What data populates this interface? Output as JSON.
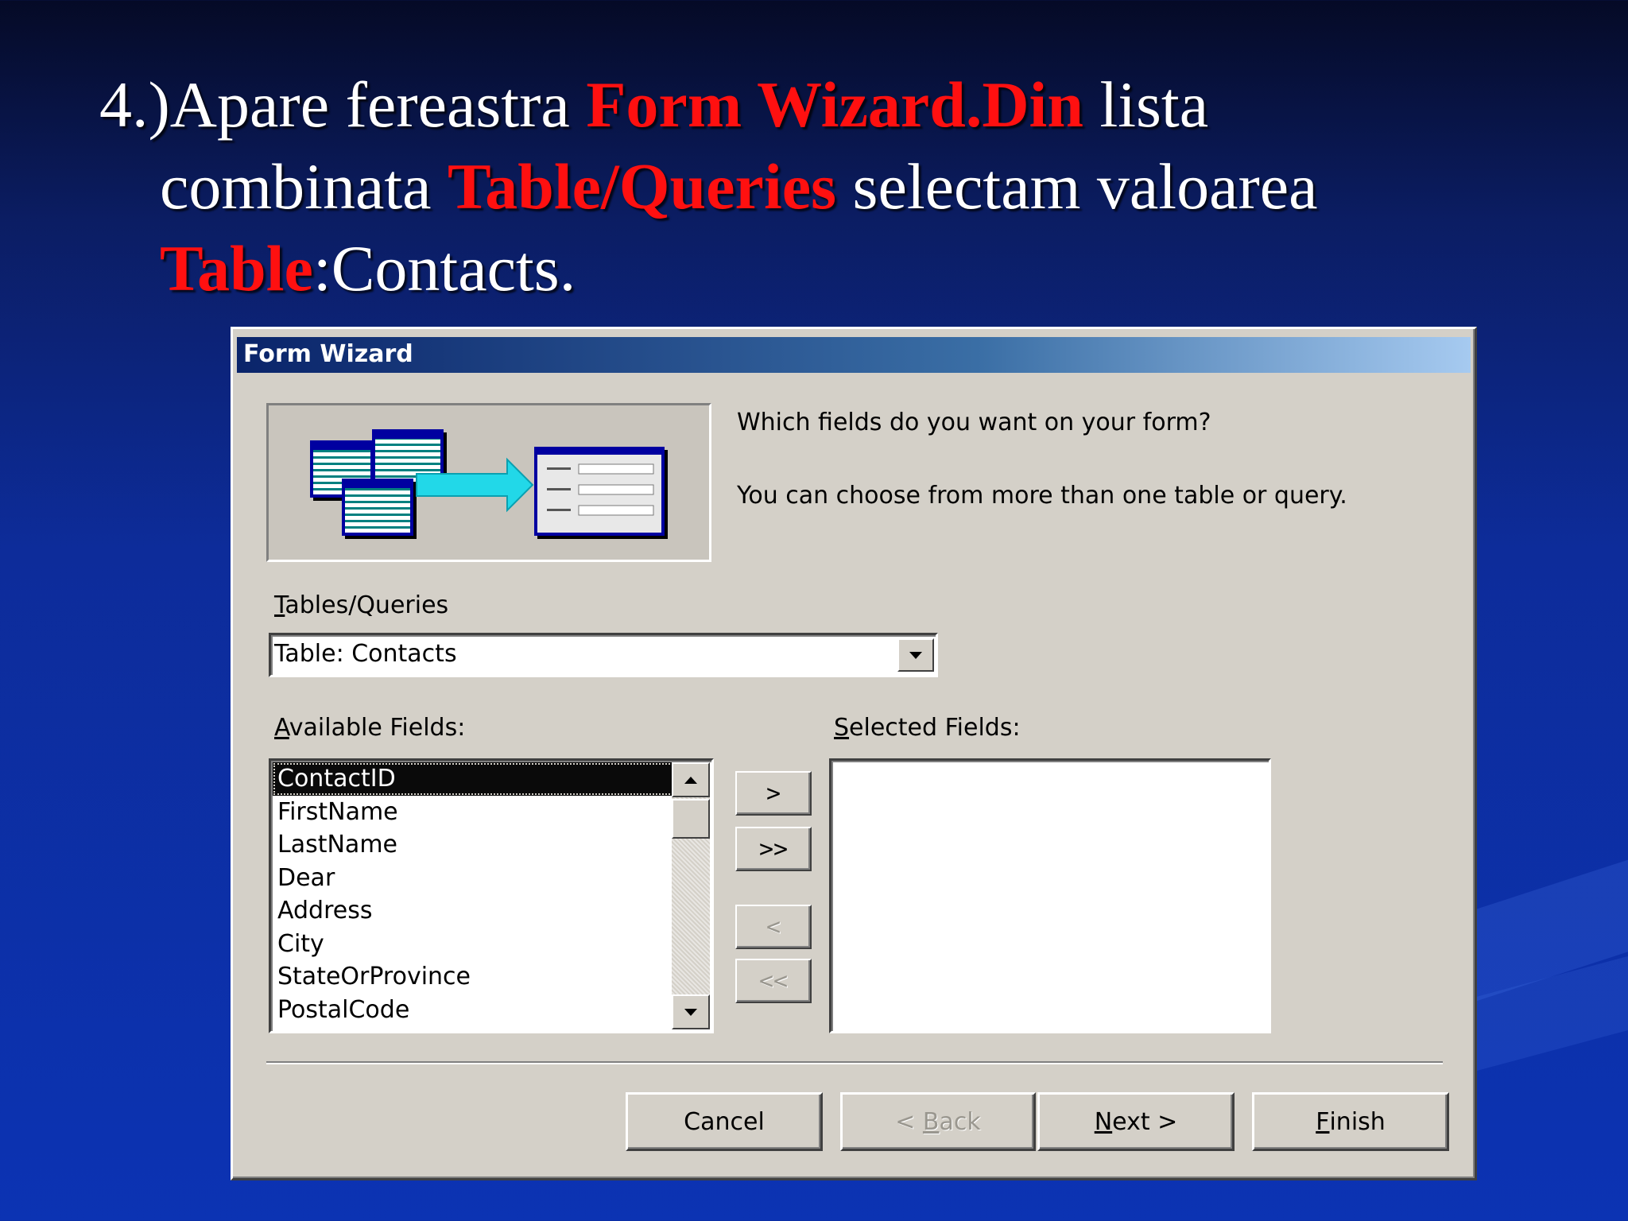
{
  "slide": {
    "line1_a": "4.)Apare fereastra ",
    "line1_red": "Form Wizard.Din",
    "line1_b": " lista",
    "line2_a": "combinata ",
    "line2_red": "Table/Queries",
    "line2_b": " selectam valoarea",
    "line3_red": "Table",
    "line3_b": ":Contacts.",
    "highlight_color": "#ff1010"
  },
  "dialog": {
    "title": "Form Wizard",
    "question": "Which fields do you want on your form?",
    "hint": "You can choose from more than one table or query.",
    "tables_label": {
      "mnemonic": "T",
      "rest": "ables/Queries"
    },
    "combo_value": "Table: Contacts",
    "available_label": {
      "mnemonic": "A",
      "rest": "vailable Fields:"
    },
    "selected_label": {
      "mnemonic": "S",
      "rest": "elected Fields:"
    },
    "available_fields": [
      "ContactID",
      "FirstName",
      "LastName",
      "Dear",
      "Address",
      "City",
      "StateOrProvince",
      "PostalCode"
    ],
    "selected_fields": [],
    "move_buttons": {
      "add_one": ">",
      "add_all": ">>",
      "remove_one": "<",
      "remove_all": "<<"
    },
    "buttons": {
      "cancel": "Cancel",
      "back": {
        "prefix": "< ",
        "mnemonic": "B",
        "rest": "ack"
      },
      "next": {
        "mnemonic": "N",
        "rest": "ext >"
      },
      "finish": {
        "mnemonic": "F",
        "rest": "inish"
      }
    }
  }
}
